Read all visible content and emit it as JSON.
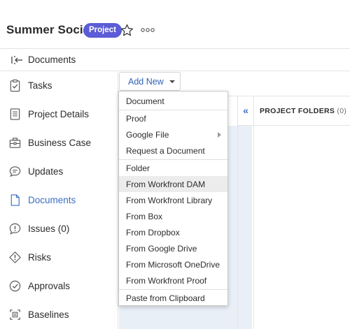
{
  "header": {
    "project_title": "Summer Social",
    "badge": "Project",
    "icons": [
      "star-icon",
      "more-options-icon"
    ]
  },
  "breadcrumb": {
    "label": "Documents",
    "icon": "collapse-sidebar-icon"
  },
  "sidebar": {
    "items": [
      {
        "label": "Tasks",
        "icon": "tasks-clipboard-icon",
        "active": false
      },
      {
        "label": "Project Details",
        "icon": "document-lines-icon",
        "active": false
      },
      {
        "label": "Business Case",
        "icon": "briefcase-icon",
        "active": false
      },
      {
        "label": "Updates",
        "icon": "chat-bubble-icon",
        "active": false
      },
      {
        "label": "Documents",
        "icon": "file-icon",
        "active": true
      },
      {
        "label": "Issues (0)",
        "icon": "issue-bubble-icon",
        "active": false
      },
      {
        "label": "Risks",
        "icon": "risk-diamond-icon",
        "active": false
      },
      {
        "label": "Approvals",
        "icon": "approval-check-icon",
        "active": false
      },
      {
        "label": "Baselines",
        "icon": "baseline-icon",
        "active": false
      }
    ]
  },
  "toolbar": {
    "add_new_label": "Add New"
  },
  "folders_panel": {
    "collapse_glyph": "«",
    "title": "PROJECT FOLDERS",
    "count": "(0)"
  },
  "dropdown": {
    "items": [
      {
        "label": "Document"
      },
      {
        "label": "Proof"
      },
      {
        "label": "Google File",
        "has_submenu": true
      },
      {
        "label": "Request a Document"
      },
      {
        "label": "Folder"
      },
      {
        "label": "From Workfront DAM",
        "hovered": true
      },
      {
        "label": "From Workfront Library"
      },
      {
        "label": "From Box"
      },
      {
        "label": "From Dropbox"
      },
      {
        "label": "From Google Drive"
      },
      {
        "label": "From Microsoft OneDrive"
      },
      {
        "label": "From Workfront Proof"
      },
      {
        "label": "Paste from Clipboard"
      }
    ]
  },
  "colors": {
    "accent": "#3b6fc2",
    "badge_bg": "#5c5cd6",
    "panel_bg": "#e9eff7",
    "hover_bg": "#ececec"
  }
}
